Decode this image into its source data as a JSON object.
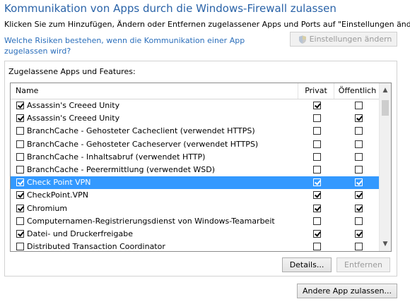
{
  "header": {
    "title": "Kommunikation von Apps durch die Windows-Firewall zulassen",
    "subtitle": "Klicken Sie zum Hinzufügen, Ändern oder Entfernen zugelassener Apps und Ports auf \"Einstellungen ändern\".",
    "risk_link": "Welche Risiken bestehen, wenn die Kommunikation einer App zugelassen wird?",
    "settings_button": "Einstellungen ändern",
    "settings_icon": "uac-shield-icon"
  },
  "apps_group": {
    "label": "Zugelassene Apps und Features:",
    "columns": {
      "name": "Name",
      "private": "Privat",
      "public": "Öffentlich"
    },
    "rows": [
      {
        "name": "Assassin's Creeed Unity",
        "enabled": true,
        "private": true,
        "public": false,
        "selected": false
      },
      {
        "name": "Assassin's Creeed Unity",
        "enabled": true,
        "private": false,
        "public": true,
        "selected": false
      },
      {
        "name": "BranchCache - Gehosteter Cacheclient (verwendet HTTPS)",
        "enabled": false,
        "private": false,
        "public": false,
        "selected": false
      },
      {
        "name": "BranchCache - Gehosteter Cacheserver (verwendet HTTPS)",
        "enabled": false,
        "private": false,
        "public": false,
        "selected": false
      },
      {
        "name": "BranchCache - Inhaltsabruf (verwendet HTTP)",
        "enabled": false,
        "private": false,
        "public": false,
        "selected": false
      },
      {
        "name": "BranchCache - Peerermittlung (verwendet WSD)",
        "enabled": false,
        "private": false,
        "public": false,
        "selected": false
      },
      {
        "name": "Check Point VPN",
        "enabled": true,
        "private": true,
        "public": true,
        "selected": true
      },
      {
        "name": "CheckPoint.VPN",
        "enabled": true,
        "private": true,
        "public": true,
        "selected": false
      },
      {
        "name": "Chromium",
        "enabled": true,
        "private": true,
        "public": true,
        "selected": false
      },
      {
        "name": "Computernamen-Registrierungsdienst von Windows-Teamarbeit",
        "enabled": false,
        "private": false,
        "public": false,
        "selected": false
      },
      {
        "name": "Datei- und Druckerfreigabe",
        "enabled": true,
        "private": true,
        "public": true,
        "selected": false
      },
      {
        "name": "Distributed Transaction Coordinator",
        "enabled": false,
        "private": false,
        "public": false,
        "selected": false
      }
    ],
    "details_button": "Details...",
    "remove_button": "Entfernen"
  },
  "footer": {
    "add_app_button": "Andere App zulassen..."
  },
  "colors": {
    "title": "#2a63a8",
    "link": "#2a6ebb",
    "selection": "#3399ff"
  }
}
